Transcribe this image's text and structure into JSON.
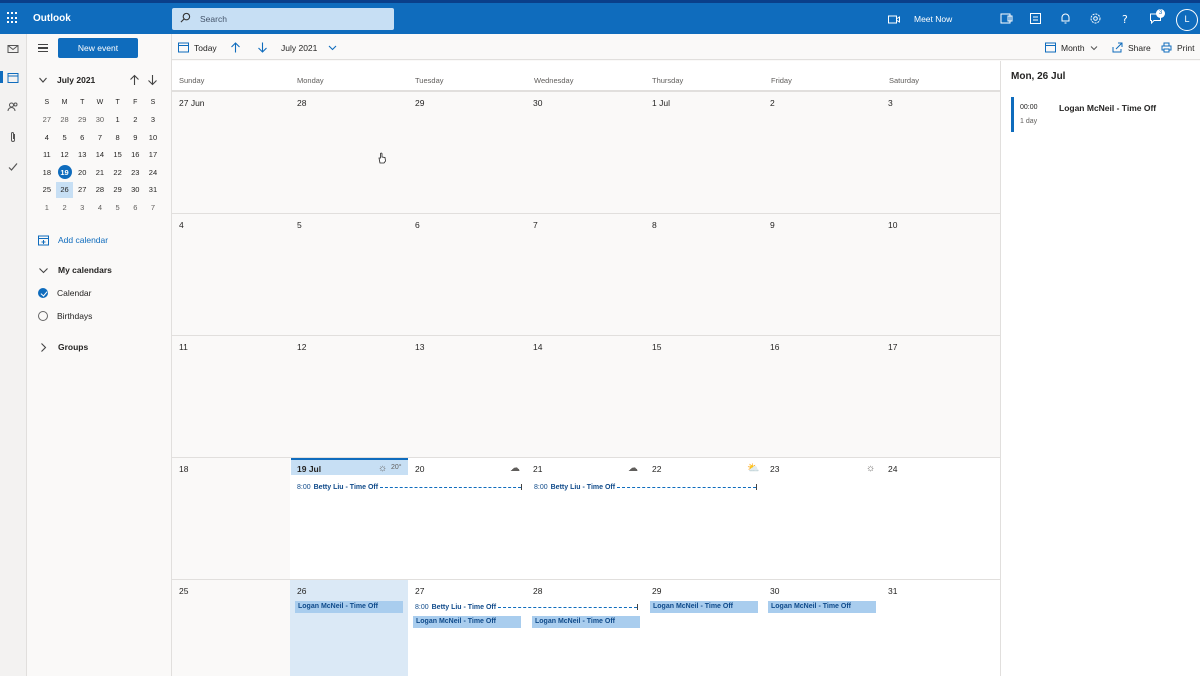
{
  "topbar": {
    "app_name": "Outlook",
    "search_placeholder": "Search",
    "meet_now": "Meet Now",
    "notification_count": "3",
    "avatar_initial": "L",
    "accent": "#0f6cbd"
  },
  "sidebar": {
    "new_event": "New event",
    "mini_month": "July 2021",
    "dow": [
      "S",
      "M",
      "T",
      "W",
      "T",
      "F",
      "S"
    ],
    "weeks": [
      [
        "27",
        "28",
        "29",
        "30",
        "1",
        "2",
        "3"
      ],
      [
        "4",
        "5",
        "6",
        "7",
        "8",
        "9",
        "10"
      ],
      [
        "11",
        "12",
        "13",
        "14",
        "15",
        "16",
        "17"
      ],
      [
        "18",
        "19",
        "20",
        "21",
        "22",
        "23",
        "24"
      ],
      [
        "25",
        "26",
        "27",
        "28",
        "29",
        "30",
        "31"
      ],
      [
        "1",
        "2",
        "3",
        "4",
        "5",
        "6",
        "7"
      ]
    ],
    "add_calendar": "Add calendar",
    "my_calendars": "My calendars",
    "calendars": [
      {
        "label": "Calendar",
        "checked": true
      },
      {
        "label": "Birthdays",
        "checked": false
      }
    ],
    "groups": "Groups"
  },
  "toolbar": {
    "today": "Today",
    "month_label": "July 2021",
    "view": "Month",
    "share": "Share",
    "print": "Print"
  },
  "day_names": [
    "Sunday",
    "Monday",
    "Tuesday",
    "Wednesday",
    "Thursday",
    "Friday",
    "Saturday"
  ],
  "weeks": [
    [
      "27 Jun",
      "28",
      "29",
      "30",
      "1 Jul",
      "2",
      "3"
    ],
    [
      "4",
      "5",
      "6",
      "7",
      "8",
      "9",
      "10"
    ],
    [
      "11",
      "12",
      "13",
      "14",
      "15",
      "16",
      "17"
    ],
    [
      "18",
      "19 Jul",
      "20",
      "21",
      "22",
      "23",
      "24"
    ],
    [
      "25",
      "26",
      "27",
      "28",
      "29",
      "30",
      "31"
    ]
  ],
  "weather": {
    "today_temp": "20°"
  },
  "events": {
    "betty_time": "8:00",
    "betty_name": "Betty Liu - Time Off",
    "logan_name": "Logan McNeil - Time Off"
  },
  "detail_pane": {
    "title": "Mon, 26 Jul",
    "event_time": "00:00",
    "event_duration": "1 day",
    "event_name": "Logan McNeil - Time Off"
  }
}
